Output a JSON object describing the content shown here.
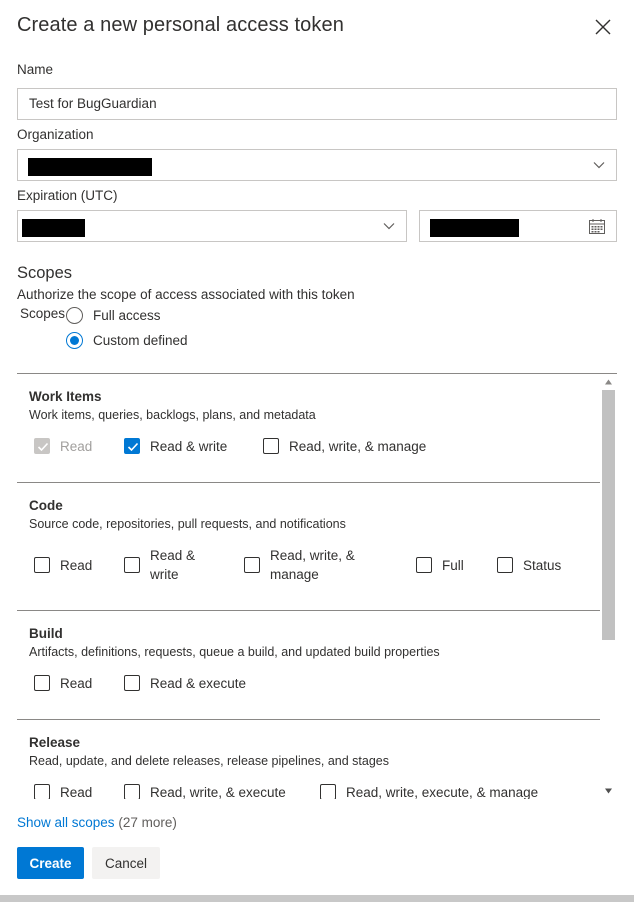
{
  "dialog": {
    "title": "Create a new personal access token"
  },
  "form": {
    "name_label": "Name",
    "name_value": "Test for BugGuardian",
    "organization_label": "Organization",
    "expiration_label": "Expiration (UTC)"
  },
  "scopes": {
    "heading": "Scopes",
    "description": "Authorize the scope of access associated with this token",
    "radio_group_label": "Scopes",
    "options": [
      "Full access",
      "Custom defined"
    ],
    "selected": "Custom defined"
  },
  "scope_groups": [
    {
      "title": "Work Items",
      "description": "Work items, queries, backlogs, plans, and metadata",
      "options": [
        {
          "label": "Read",
          "checked": true,
          "disabled": true
        },
        {
          "label": "Read & write",
          "checked": true,
          "disabled": false
        },
        {
          "label": "Read, write, & manage",
          "checked": false,
          "disabled": false
        }
      ]
    },
    {
      "title": "Code",
      "description": "Source code, repositories, pull requests, and notifications",
      "options": [
        {
          "label": "Read",
          "checked": false
        },
        {
          "label_line1": "Read &",
          "label_line2": "write",
          "checked": false
        },
        {
          "label_line1": "Read, write, &",
          "label_line2": "manage",
          "checked": false
        },
        {
          "label": "Full",
          "checked": false
        },
        {
          "label": "Status",
          "checked": false
        }
      ]
    },
    {
      "title": "Build",
      "description": "Artifacts, definitions, requests, queue a build, and updated build properties",
      "options": [
        {
          "label": "Read",
          "checked": false
        },
        {
          "label": "Read & execute",
          "checked": false
        }
      ]
    },
    {
      "title": "Release",
      "description": "Read, update, and delete releases, release pipelines, and stages",
      "options": [
        {
          "label": "Read",
          "checked": false
        },
        {
          "label": "Read, write, & execute",
          "checked": false
        },
        {
          "label": "Read, write, execute, & manage",
          "checked": false
        }
      ]
    }
  ],
  "footer": {
    "show_all_link": "Show all scopes",
    "show_all_count": "(27 more)",
    "create_label": "Create",
    "cancel_label": "Cancel"
  },
  "colors": {
    "accent": "#0078d4",
    "text": "#323130",
    "border": "#c8c6c4"
  },
  "icons": [
    "close-icon",
    "chevron-down-icon",
    "calendar-icon",
    "checkmark-icon"
  ]
}
